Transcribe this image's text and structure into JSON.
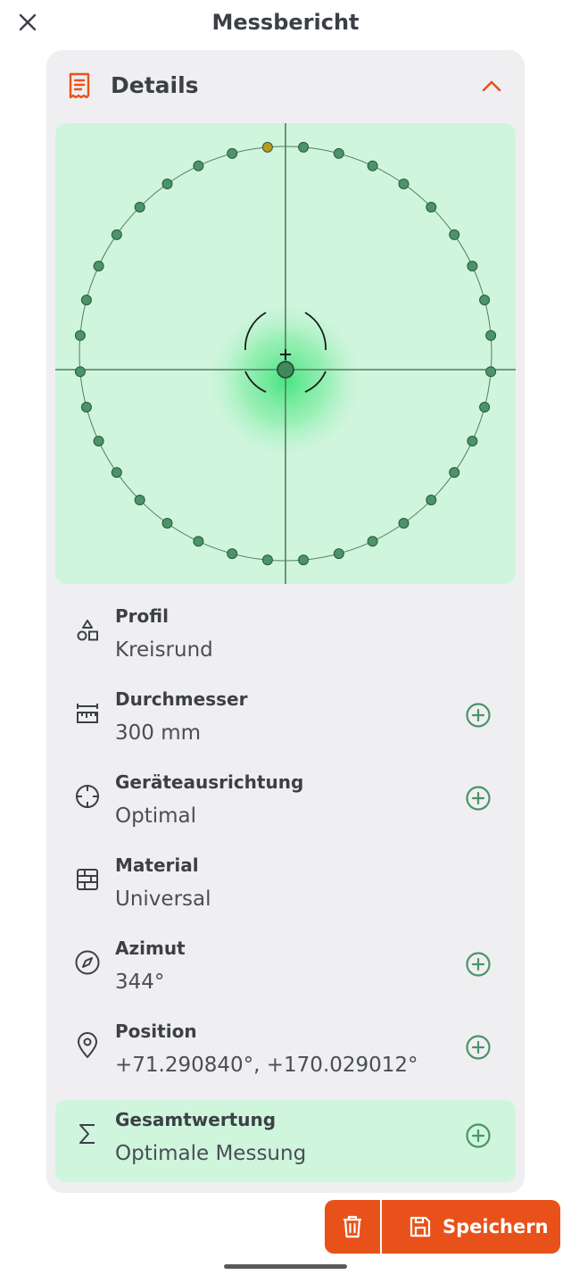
{
  "header": {
    "title": "Messbericht",
    "close_icon": "close-icon"
  },
  "details": {
    "title": "Details",
    "icon": "receipt-icon",
    "collapse_icon": "chevron-up-icon"
  },
  "colors": {
    "accent": "#e8521a",
    "plot_bg": "#d0f5dd",
    "point": "#4a9468",
    "point_highlight": "#b89a1c",
    "add_icon": "#4a9468",
    "card_bg": "#efeff1"
  },
  "plot": {
    "point_count": 36,
    "highlighted_point": 35
  },
  "rows": [
    {
      "label": "Profil",
      "value": "Kreisrund",
      "icon": "shapes-icon",
      "has_add": false
    },
    {
      "label": "Durchmesser",
      "value": "300 mm",
      "icon": "ruler-icon",
      "has_add": true
    },
    {
      "label": "Geräteausrichtung",
      "value": "Optimal",
      "icon": "crosshair-icon",
      "has_add": true
    },
    {
      "label": "Material",
      "value": "Universal",
      "icon": "brick-wall-icon",
      "has_add": false
    },
    {
      "label": "Azimut",
      "value": "344°",
      "icon": "compass-icon",
      "has_add": true
    },
    {
      "label": "Position",
      "value": "+71.290840°, +170.029012°",
      "icon": "location-pin-icon",
      "has_add": true
    }
  ],
  "total": {
    "label": "Gesamtwertung",
    "value": "Optimale Messung",
    "icon": "sigma-icon",
    "has_add": true
  },
  "actions": {
    "delete_icon": "trash-icon",
    "save_label": "Speichern",
    "save_icon": "save-icon"
  }
}
